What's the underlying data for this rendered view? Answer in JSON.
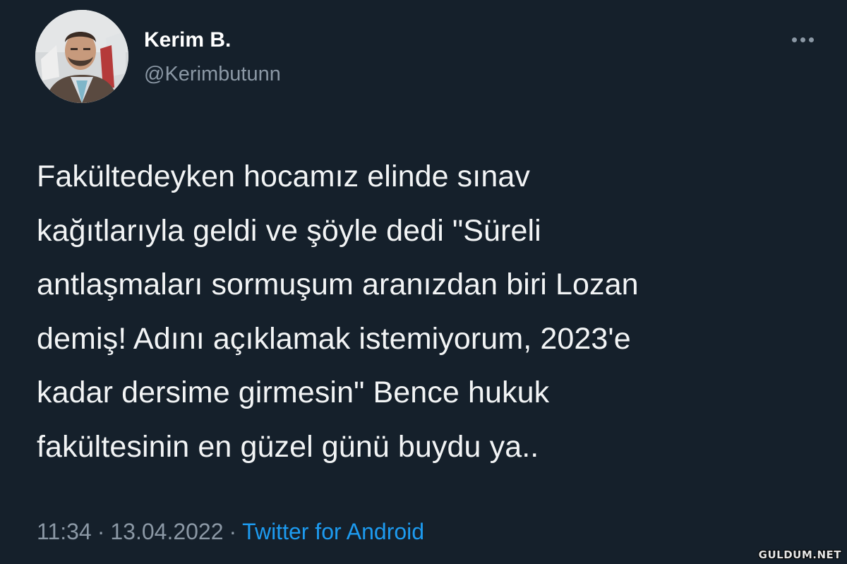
{
  "author": {
    "display_name": "Kerim B.",
    "handle": "@Kerimbutunn",
    "avatar_icon": "profile-photo-avatar"
  },
  "more_icon": "ellipsis-icon",
  "tweet": {
    "lines": [
      "Fakültedeyken hocamız elinde sınav",
      "kağıtlarıyla geldi ve şöyle dedi \"Süreli",
      "antlaşmaları sormuşum aranızdan biri Lozan",
      "demiş! Adını açıklamak istemiyorum, 2023'e",
      "kadar dersime girmesin\"  Bence hukuk",
      "fakültesinin en güzel günü buydu ya.."
    ]
  },
  "meta": {
    "time": "11:34",
    "separator": "·",
    "date": "13.04.2022",
    "source": "Twitter for Android"
  },
  "watermark": "GULDUM.NET",
  "colors": {
    "background": "#15202b",
    "text": "#f2f4f5",
    "secondary": "#8b98a5",
    "link": "#1d9bf0"
  }
}
